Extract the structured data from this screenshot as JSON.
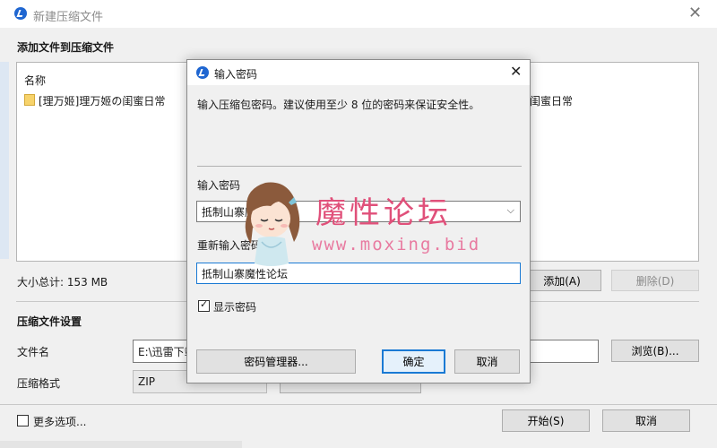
{
  "colors": {
    "dialog_bg": "#f0f0f0",
    "accent": "#1a7ad4",
    "watermark_title": "#e0507a",
    "watermark_url": "#e87aa0"
  },
  "main_window": {
    "title": "新建压缩文件",
    "section_add_title": "添加文件到压缩文件",
    "file_list": {
      "header_name": "名称",
      "items": [
        {
          "icon": "folder-icon",
          "name": "[理万姬]理万姬の闺蜜日常"
        }
      ],
      "right_items": [
        {
          "name": "闺蜜日常"
        }
      ]
    },
    "total_size": "大小总计: 153 MB",
    "add_button": "添加(A)",
    "remove_button": "删除(D)",
    "section_settings_title": "压缩文件设置",
    "filename_label": "文件名",
    "filename_value": "E:\\迅雷下载",
    "browse_button": "浏览(B)...",
    "format_label": "压缩格式",
    "format_value": "ZIP",
    "more_options_label": "更多选项...",
    "start_button": "开始(S)",
    "cancel_button": "取消"
  },
  "password_dialog": {
    "title": "输入密码",
    "description": "输入压缩包密码。建议使用至少 8 位的密码来保证安全性。",
    "enter_label": "输入密码",
    "enter_value": "抵制山寨魔性论坛",
    "reenter_label": "重新输入密码",
    "reenter_value": "抵制山寨魔性论坛",
    "show_password_label": "显示密码",
    "show_password_checked": true,
    "manager_button": "密码管理器...",
    "ok_button": "确定",
    "cancel_button": "取消"
  },
  "watermark": {
    "title": "魔性论坛",
    "url": "www.moxing.bid"
  }
}
